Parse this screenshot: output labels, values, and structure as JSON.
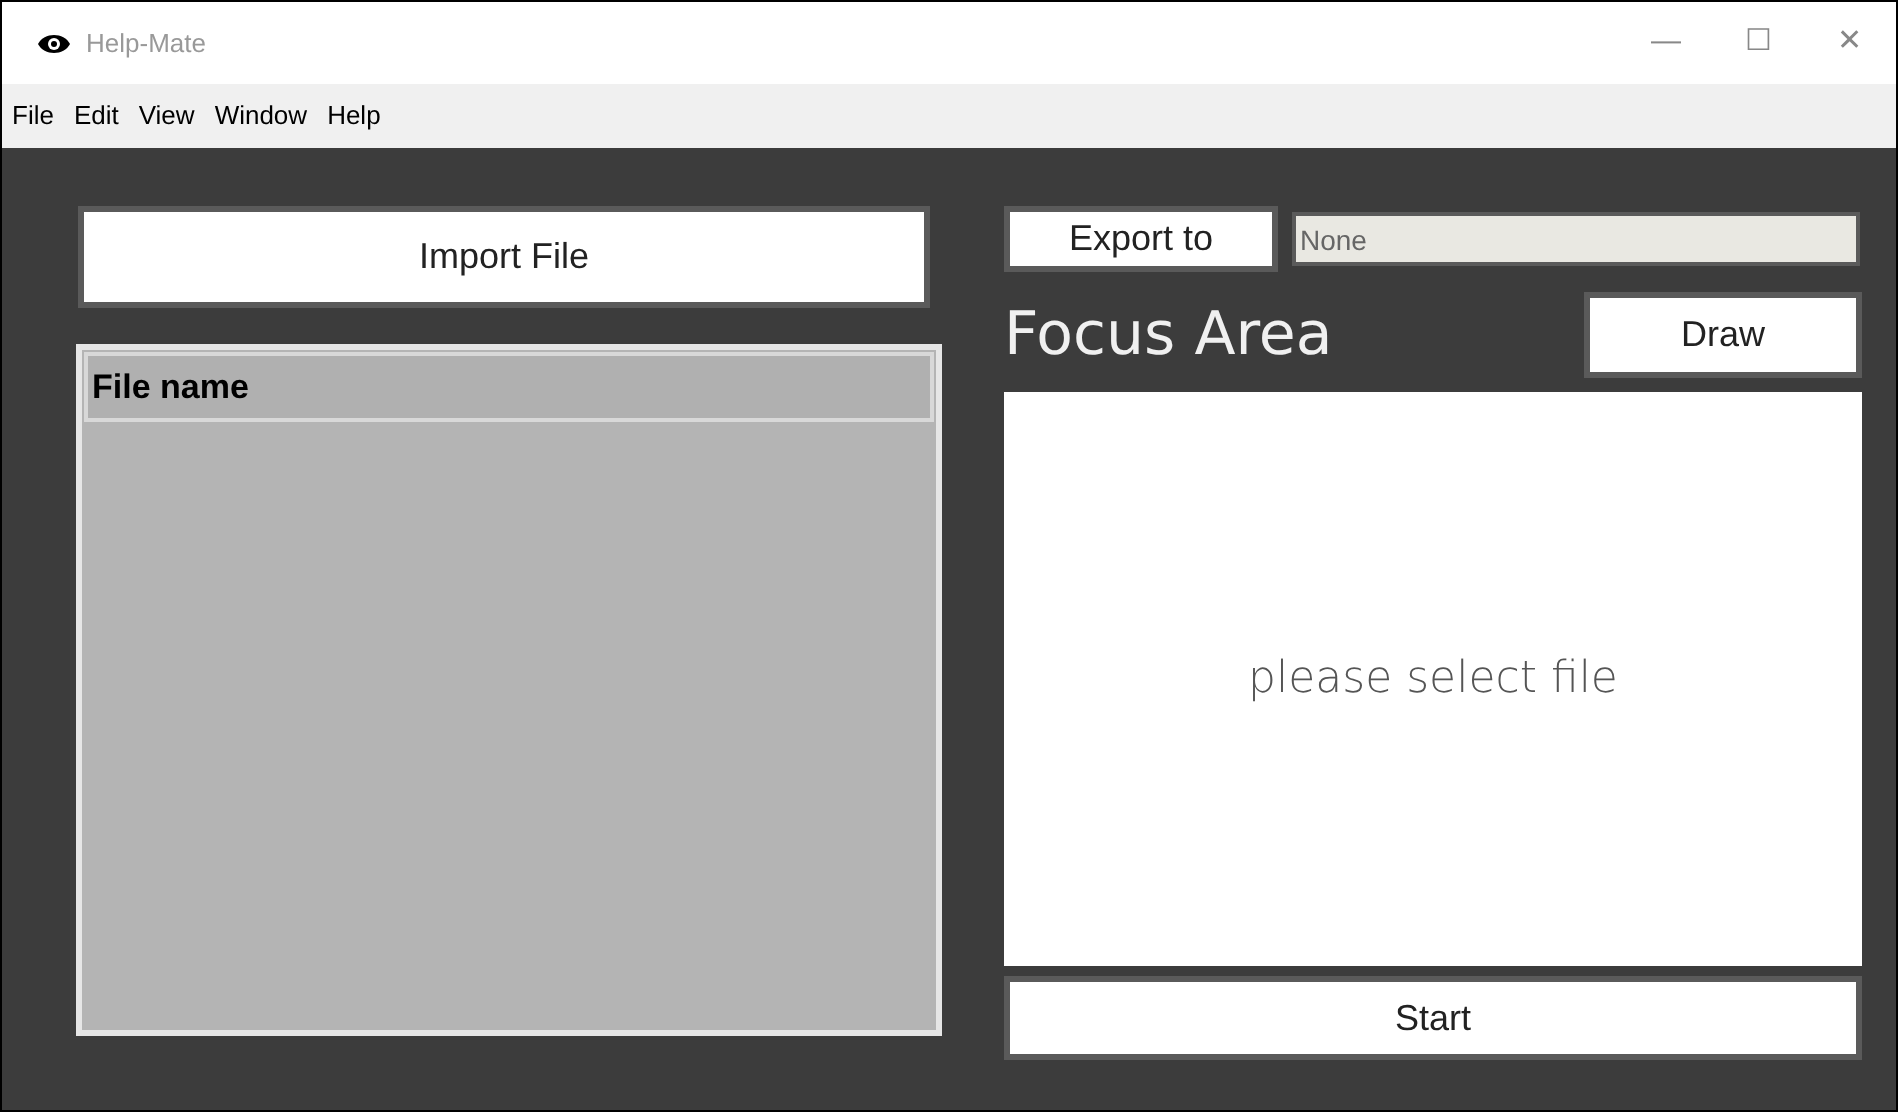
{
  "window": {
    "title": "Help-Mate",
    "controls": [
      "—",
      "☐",
      "✕"
    ]
  },
  "menu": [
    "File",
    "Edit",
    "View",
    "Window",
    "Help"
  ],
  "import_button": "Import File",
  "file_list": {
    "columns": [
      "File name"
    ]
  },
  "export": {
    "button": "Export to",
    "value": "None"
  },
  "focus_area": {
    "title": "Focus Area",
    "draw_button": "Draw",
    "placeholder": "please select file"
  },
  "start_button": "Start"
}
